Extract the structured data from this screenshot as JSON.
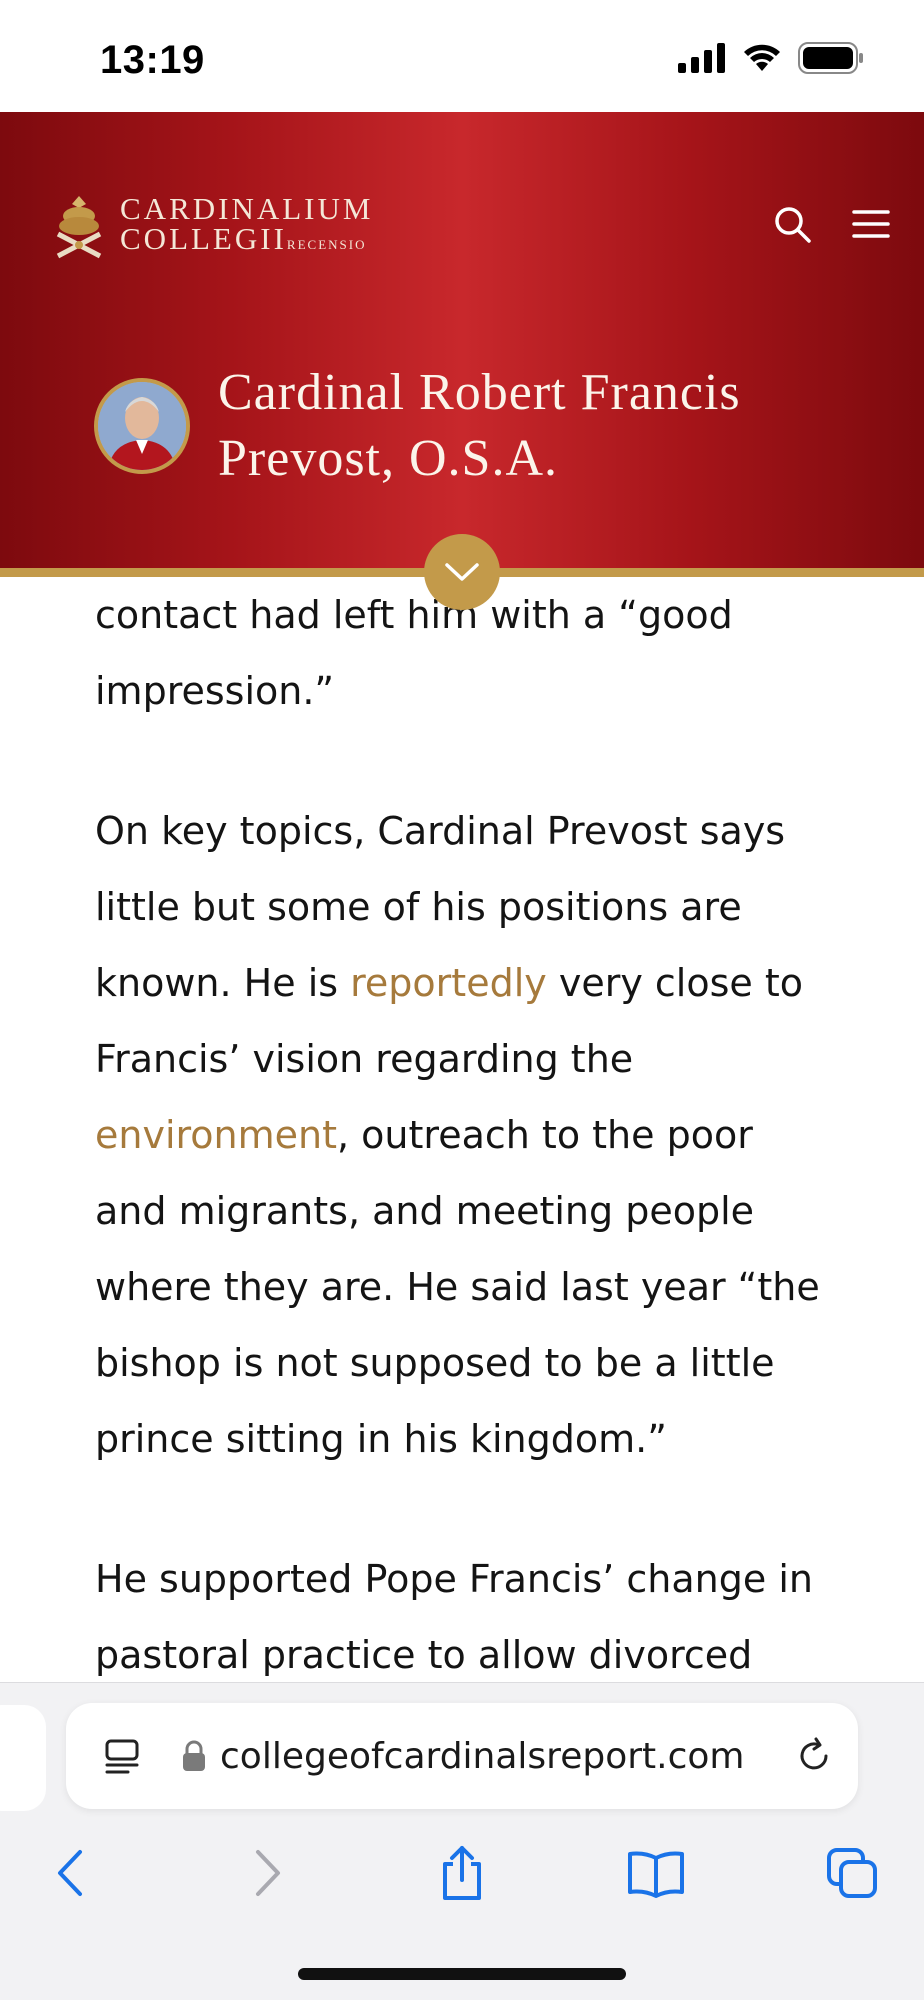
{
  "status_bar": {
    "time": "13:19"
  },
  "header": {
    "logo": {
      "line1": "CARDINALIUM",
      "line2": "COLLEGII",
      "line2_small": "RECENSIO"
    },
    "title_line1": "Cardinal Robert Francis",
    "title_line2": "Prevost, O.S.A.",
    "colors": {
      "primary_red": "#a51419",
      "gold": "#c39a4a"
    }
  },
  "article": {
    "para1": [
      "contact had left him with a “good impression.”"
    ],
    "para2": {
      "t1": "On key topics, Cardinal Prevost says little but some of his positions are known. He is ",
      "link1": "reportedly",
      "t2": " very close to Francis’ vision regarding the ",
      "link2": "environment",
      "t3": ", outreach to the poor and migrants, and meeting people where they are. He said last year “the bishop is not supposed to be a little prince sitting in his kingdom.”"
    },
    "para3": "He supported Pope Francis’ change in pastoral practice to allow divorced",
    "link_color": "#a67a3c"
  },
  "browser": {
    "url": "collegeofcardinalsreport.com",
    "icons": [
      "reader-icon",
      "lock-icon",
      "reload-icon",
      "back-icon",
      "forward-icon",
      "share-icon",
      "bookmarks-icon",
      "tabs-icon"
    ]
  }
}
